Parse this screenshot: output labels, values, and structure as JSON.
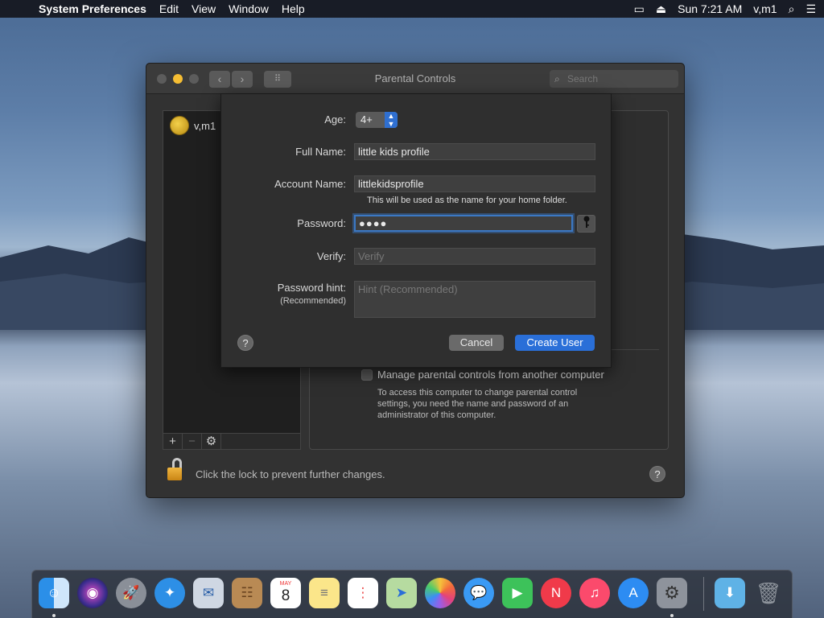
{
  "menubar": {
    "app_name": "System Preferences",
    "items": [
      "Edit",
      "View",
      "Window",
      "Help"
    ],
    "clock": "Sun 7:21 AM",
    "user": "v,m1"
  },
  "window": {
    "title": "Parental Controls",
    "search_placeholder": "Search"
  },
  "sidebar": {
    "user_name": "v,m1",
    "tools": [
      "+",
      "−",
      "⚙"
    ]
  },
  "panel": {
    "manage_label": "Manage parental controls from another computer",
    "manage_description": "To access this computer to change parental control settings, you need the name and password of an administrator of this computer."
  },
  "footer": {
    "lock_text": "Click the lock to prevent further changes.",
    "help": "?"
  },
  "sheet": {
    "age_label": "Age:",
    "age_value": "4+",
    "full_name_label": "Full Name:",
    "full_name_value": "little kids profile",
    "account_name_label": "Account Name:",
    "account_name_value": "littlekidsprofile",
    "home_folder_note": "This will be used as the name for your home folder.",
    "password_label": "Password:",
    "password_value": "●●●●",
    "verify_label": "Verify:",
    "verify_placeholder": "Verify",
    "hint_label": "Password hint:",
    "hint_sublabel": "(Recommended)",
    "hint_placeholder": "Hint (Recommended)",
    "help": "?",
    "cancel_label": "Cancel",
    "create_label": "Create User"
  },
  "dock": {
    "apps": [
      "finder-icon",
      "siri-icon",
      "launchpad-icon",
      "safari-icon",
      "mail-icon",
      "contacts-icon",
      "calendar-icon",
      "notes-icon",
      "reminders-icon",
      "maps-icon",
      "photos-icon",
      "messages-icon",
      "facetime-icon",
      "news-icon",
      "music-icon",
      "app-store-icon",
      "system-preferences-icon",
      "downloads-folder-icon",
      "trash-icon"
    ],
    "calendar_month": "MAY",
    "calendar_day": "8"
  }
}
